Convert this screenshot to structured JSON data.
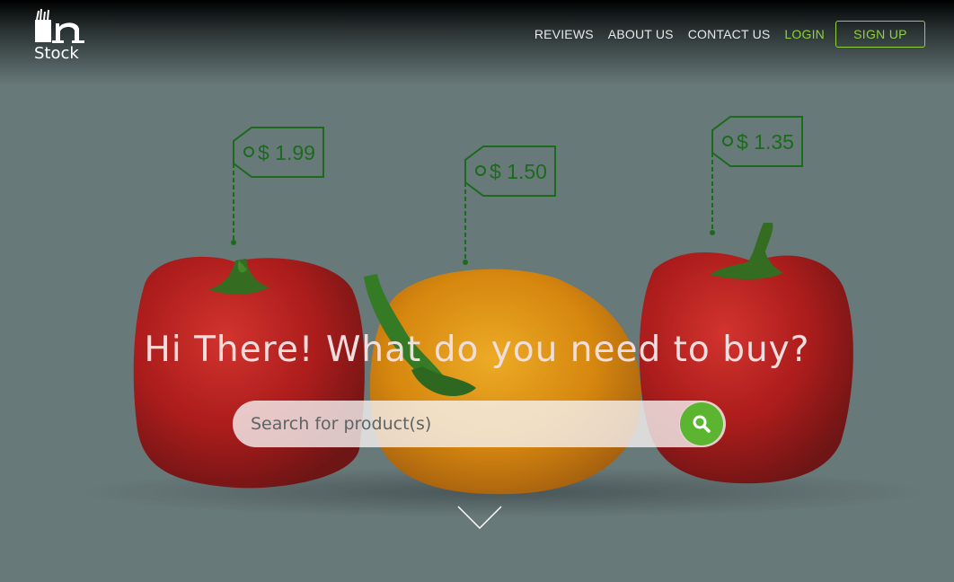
{
  "brand": {
    "name": "Stock"
  },
  "nav": {
    "links": [
      "REVIEWS",
      "ABOUT US",
      "CONTACT US"
    ],
    "login": "LOGIN",
    "signup": "SIGN UP"
  },
  "price_tags": [
    "$ 1.99",
    "$ 1.50",
    "$ 1.35"
  ],
  "hero": {
    "title": "Hi There! What do you need to buy?",
    "search_placeholder": "Search for product(s)",
    "search_value": ""
  },
  "icons": {
    "search": "search-icon",
    "scroll": "chevron-down-icon",
    "logo": "bag-logo-icon"
  },
  "colors": {
    "overlay": "#68797a",
    "accent_green": "#8fd13f",
    "search_button": "#5cb531",
    "tag_green": "#1c6a1c",
    "pepper_red": "#c4141a",
    "pepper_yellow": "#e8a000"
  }
}
